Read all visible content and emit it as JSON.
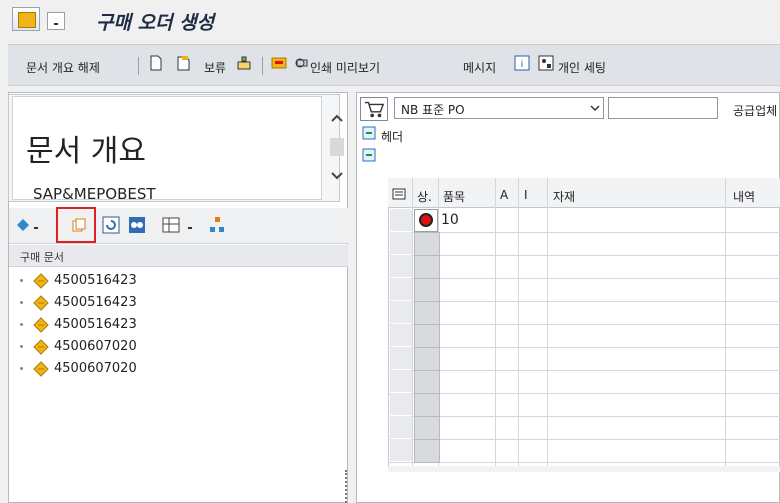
{
  "app": {
    "title": "구매 오더 생성",
    "title_icon": "sap-menu-icon",
    "title_dropdown_icon": "dropdown-icon"
  },
  "toolbar": {
    "items": [
      {
        "type": "text",
        "label": "문서 개요 해제"
      },
      {
        "type": "icon",
        "icon": "new-doc-icon"
      },
      {
        "type": "icon",
        "icon": "open-doc-icon"
      },
      {
        "type": "text",
        "label": "보류"
      },
      {
        "type": "icon",
        "icon": "check-icon"
      },
      {
        "type": "icon",
        "icon": "print-preview-icon",
        "label": "인쇄 미리보기"
      },
      {
        "type": "text",
        "label": "메시지"
      },
      {
        "type": "icon",
        "icon": "info-icon"
      },
      {
        "type": "icon",
        "icon": "personal-settings-icon",
        "label": "개인 세팅"
      }
    ]
  },
  "left_panel": {
    "overview_title": "문서 개요",
    "overview_subtitle": "SAP&MEPOBEST",
    "tree_header": "구매 문서",
    "documents": [
      "4500516423",
      "4500516423",
      "4500516423",
      "4500607020",
      "4500607020"
    ]
  },
  "right_panel": {
    "doc_type": "NB 표준 PO",
    "doc_number": "",
    "supplier_label": "공급업체",
    "header_label": "헤더",
    "grid": {
      "columns": [
        "상.",
        "품목",
        "A",
        "I",
        "자재",
        "내역"
      ],
      "rows": [
        {
          "status": "red",
          "item": "10",
          "a": "",
          "i": "",
          "material": "",
          "desc": ""
        }
      ]
    }
  },
  "colors": {
    "title_text": "#1f2a44",
    "toolbar_bg": "#dfe3e8",
    "highlight": "#e02020",
    "status_red": "#dd1111"
  }
}
